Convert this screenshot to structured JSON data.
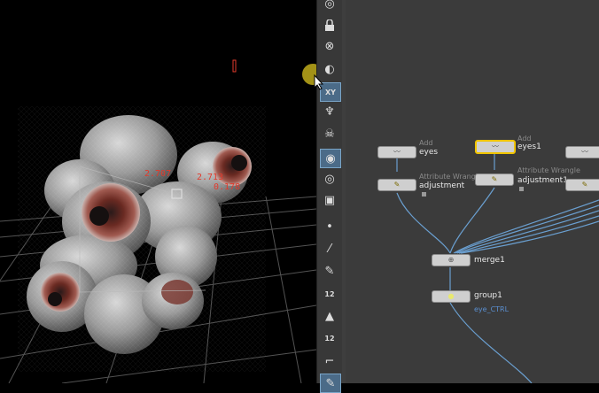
{
  "viewport": {
    "measure_labels": [
      "2.707",
      "2.713",
      "0.178"
    ]
  },
  "toolbar": {
    "tools": [
      {
        "icon": "target-icon"
      },
      {
        "icon": "lock-icon"
      },
      {
        "icon": "close-circle-icon"
      },
      {
        "icon": "light-icon"
      },
      {
        "icon": "xy-view-icon",
        "text": "XY",
        "active": true
      },
      {
        "icon": "pin-icon"
      },
      {
        "icon": "skull-icon"
      },
      {
        "icon": "shaded-view-icon",
        "active": true
      },
      {
        "icon": "eye-icon"
      },
      {
        "icon": "camera-icon"
      },
      {
        "icon": "point-icon"
      },
      {
        "icon": "brush-icon"
      },
      {
        "icon": "pen-icon"
      },
      {
        "icon": "snap-1-icon",
        "text": "12"
      },
      {
        "icon": "paint-icon"
      },
      {
        "icon": "snap-2-icon",
        "text": "12"
      },
      {
        "icon": "curve-icon"
      },
      {
        "icon": "edit-icon"
      }
    ]
  },
  "network": {
    "nodes": {
      "eyes": {
        "type": "Add",
        "name": "eyes"
      },
      "eyes1": {
        "type": "Add",
        "name": "eyes1"
      },
      "adjustment": {
        "type": "Attribute Wrangle",
        "name": "adjustment"
      },
      "adjustment1": {
        "type": "Attribute Wrangle",
        "name": "adjustment1"
      },
      "merge1": {
        "name": "merge1"
      },
      "group1": {
        "name": "group1",
        "comment": "eye_CTRL"
      }
    }
  },
  "colors": {
    "measure": "#e23a2c",
    "selected": "#f0c400",
    "wire": "#6a9fd0",
    "network_bg": "#3b3b3b"
  }
}
